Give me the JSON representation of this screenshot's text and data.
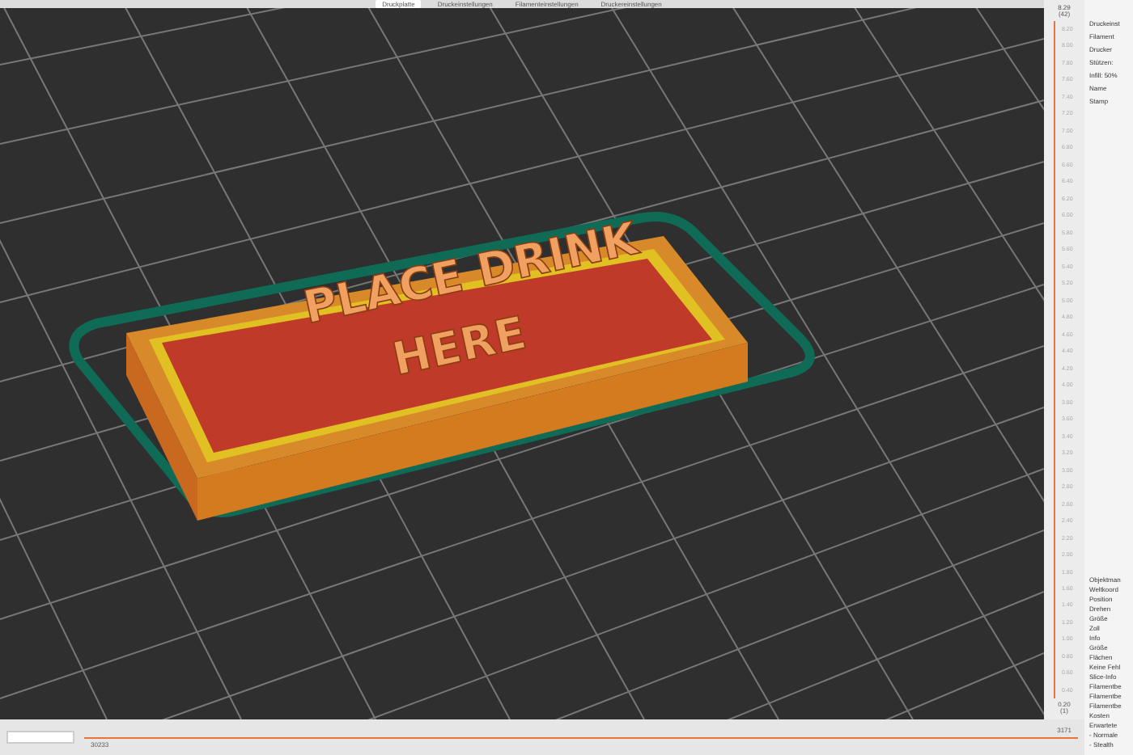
{
  "tabs": [
    {
      "label": "Druckplatte",
      "selected": true
    },
    {
      "label": "Druckeinstellungen",
      "selected": false
    },
    {
      "label": "Filamenteinstellungen",
      "selected": false
    },
    {
      "label": "Druckereinstellungen",
      "selected": false
    }
  ],
  "model_text": [
    "PLACE DRINK",
    "HERE"
  ],
  "layer_ruler": {
    "top_value": "8.29",
    "top_layer": "(42)",
    "bottom_value": "0.20",
    "bottom_layer": "(1)",
    "level": 1,
    "ticks": [
      "8.20",
      "8.00",
      "7.80",
      "7.60",
      "7.40",
      "7.20",
      "7.00",
      "6.80",
      "6.60",
      "6.40",
      "6.20",
      "6.00",
      "5.80",
      "5.60",
      "5.40",
      "5.20",
      "5.00",
      "4.80",
      "4.60",
      "4.40",
      "4.20",
      "4.00",
      "3.80",
      "3.60",
      "3.40",
      "3.20",
      "3.00",
      "2.80",
      "2.60",
      "2.40",
      "2.20",
      "2.00",
      "1.80",
      "1.60",
      "1.40",
      "1.20",
      "1.00",
      "0.80",
      "0.60",
      "0.40"
    ]
  },
  "side_panel_top": [
    "Druckeinst",
    "Filament",
    "Drucker",
    "Stützen:",
    "Infill: 50%",
    "Name",
    "Stamp"
  ],
  "side_panel_bottom": [
    "Objektman",
    "Weltkoord",
    "Position",
    "Drehen",
    "Größe",
    "Zoll",
    "Info",
    "Größe",
    "Flächen",
    "Keine Fehl",
    "Slice-Info",
    "Filamentbe",
    "Filamentbe",
    "Filamentbe",
    "Kosten",
    "Erwartete",
    "- Normale",
    "- Stealth"
  ],
  "move_slider": {
    "start": "30233",
    "end": "3171",
    "level": 1
  }
}
